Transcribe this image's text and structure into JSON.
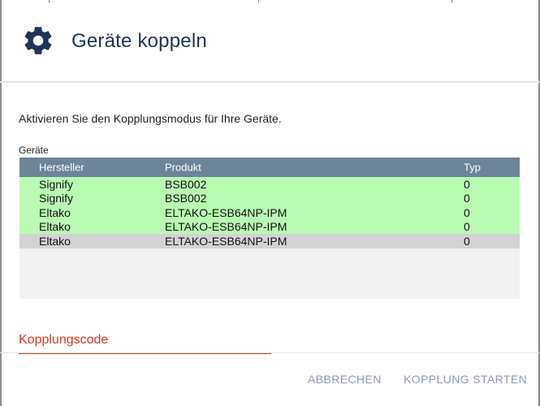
{
  "dialog": {
    "title": "Geräte koppeln",
    "icon": "gear-icon",
    "title_color": "#1d3557"
  },
  "instruction": "Aktivieren Sie den Kopplungsmodus für Ihre Geräte.",
  "devices": {
    "label": "Geräte",
    "columns": [
      "Hersteller",
      "Produkt",
      "Typ"
    ],
    "rows": [
      {
        "manufacturer": "Signify",
        "product": "BSB002",
        "type": "0",
        "status": "green"
      },
      {
        "manufacturer": "Signify",
        "product": "BSB002",
        "type": "0",
        "status": "green"
      },
      {
        "manufacturer": "Eltako",
        "product": "ELTAKO-ESB64NP-IPM",
        "type": "0",
        "status": "green"
      },
      {
        "manufacturer": "Eltako",
        "product": "ELTAKO-ESB64NP-IPM",
        "type": "0",
        "status": "green"
      },
      {
        "manufacturer": "Eltako",
        "product": "ELTAKO-ESB64NP-IPM",
        "type": "0",
        "status": "grey"
      }
    ],
    "colors": {
      "header": "#6d8499",
      "green_row": "#b9fbb3",
      "grey_row": "#d3d3d3"
    }
  },
  "pairing_code": {
    "label": "Kopplungscode",
    "value": "",
    "color": "#d63a1c"
  },
  "footer": {
    "cancel_label": "ABBRECHEN",
    "start_label": "KOPPLUNG STARTEN",
    "button_color": "#8a9bb0"
  }
}
